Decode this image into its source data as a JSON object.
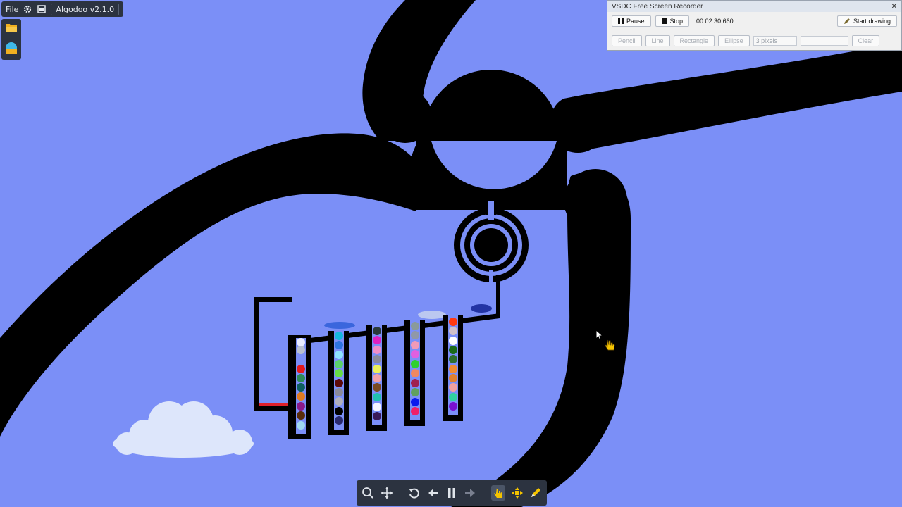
{
  "algodoo": {
    "menu_file": "File",
    "title": "Algodoo v2.1.0",
    "icons": [
      "gear-icon",
      "window-icon",
      "folder-icon",
      "scene-icon"
    ]
  },
  "recorder": {
    "title": "VSDC Free Screen Recorder",
    "close_glyph": "✕",
    "pause_label": "Pause",
    "stop_label": "Stop",
    "elapsed_time": "00:02:30.660",
    "start_drawing_label": "Start drawing",
    "tools": [
      "Pencil",
      "Line",
      "Rectangle",
      "Ellipse"
    ],
    "line_width": "3 pixels",
    "clear_label": "Clear"
  },
  "toolbar": {
    "icons": [
      "zoom-icon",
      "move-icon",
      "undo-icon",
      "rewind-icon",
      "pause-icon",
      "forward-icon",
      "drag-tool-icon",
      "move-tool-icon",
      "sketch-tool-icon"
    ]
  },
  "colors": {
    "sky": "#7b8ff7",
    "track": "#000000",
    "cloud": "#dde6fb",
    "accent": "#f5c400"
  }
}
